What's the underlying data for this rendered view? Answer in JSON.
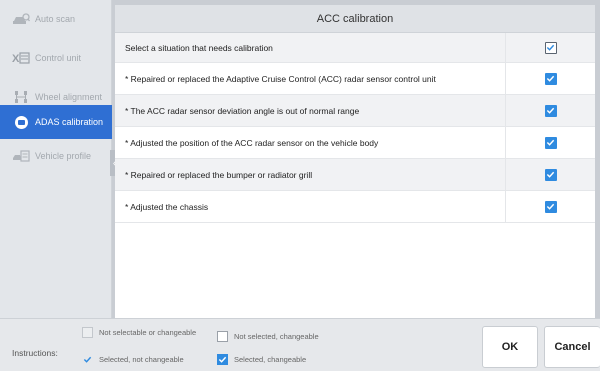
{
  "sidebar": {
    "items": [
      {
        "label": "Auto scan",
        "icon": "car-scan-icon"
      },
      {
        "label": "Control unit",
        "icon": "control-unit-icon"
      },
      {
        "label": "Wheel alignment",
        "icon": "wheel-alignment-icon"
      },
      {
        "label": "ADAS calibration",
        "icon": "adas-icon",
        "active": true
      },
      {
        "label": "Vehicle profile",
        "icon": "vehicle-profile-icon"
      }
    ]
  },
  "main": {
    "title": "ACC calibration",
    "header_row": "Select a situation that needs calibration",
    "rows": [
      "* Repaired or replaced the Adaptive Cruise Control (ACC) radar sensor control unit",
      "* The ACC radar sensor deviation angle is out of normal range",
      "* Adjusted the position of the ACC radar sensor on the vehicle body",
      "* Repaired or replaced the bumper or radiator grill",
      "* Adjusted the chassis"
    ]
  },
  "bottom": {
    "instructions_label": "Instructions:",
    "legend": {
      "not_selectable": "Not selectable or changeable",
      "not_selected_changeable": "Not selected, changeable",
      "selected_not_changeable": "Selected, not changeable",
      "selected_changeable": "Selected, changeable"
    },
    "ok_label": "OK",
    "cancel_label": "Cancel"
  },
  "colors": {
    "accent": "#2f6fd3",
    "checkbox_blue": "#2f8be0"
  }
}
